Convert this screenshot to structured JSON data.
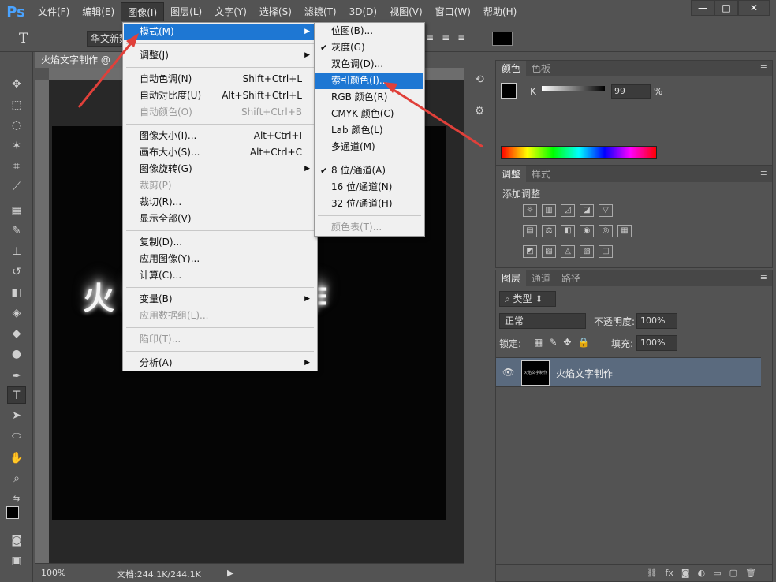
{
  "app": {
    "logo": "Ps"
  },
  "menubar": {
    "items": [
      "文件(F)",
      "编辑(E)",
      "图像(I)",
      "图层(L)",
      "文字(Y)",
      "选择(S)",
      "滤镜(T)",
      "3D(D)",
      "视图(V)",
      "窗口(W)",
      "帮助(H)"
    ],
    "active_index": 2
  },
  "window_controls": {
    "minimize": "—",
    "maximize": "□",
    "close": "✕"
  },
  "options_bar": {
    "font_family": "华文新魏"
  },
  "document": {
    "tab_title": "火焰文字制作 @",
    "canvas_text": "火焰文字制作",
    "zoom": "100%",
    "doc_info": "文档:244.1K/244.1K"
  },
  "image_menu": {
    "items": [
      {
        "label": "模式(M)",
        "shortcut": "",
        "submenu": true,
        "disabled": false,
        "highlight": true
      },
      {
        "sep": true
      },
      {
        "label": "调整(J)",
        "shortcut": "",
        "submenu": true,
        "disabled": false
      },
      {
        "sep": true
      },
      {
        "label": "自动色调(N)",
        "shortcut": "Shift+Ctrl+L",
        "disabled": false
      },
      {
        "label": "自动对比度(U)",
        "shortcut": "Alt+Shift+Ctrl+L",
        "disabled": false
      },
      {
        "label": "自动颜色(O)",
        "shortcut": "Shift+Ctrl+B",
        "disabled": true
      },
      {
        "sep": true
      },
      {
        "label": "图像大小(I)...",
        "shortcut": "Alt+Ctrl+I",
        "disabled": false
      },
      {
        "label": "画布大小(S)...",
        "shortcut": "Alt+Ctrl+C",
        "disabled": false
      },
      {
        "label": "图像旋转(G)",
        "shortcut": "",
        "submenu": true,
        "disabled": false
      },
      {
        "label": "裁剪(P)",
        "shortcut": "",
        "disabled": true
      },
      {
        "label": "裁切(R)...",
        "shortcut": "",
        "disabled": false
      },
      {
        "label": "显示全部(V)",
        "shortcut": "",
        "disabled": false
      },
      {
        "sep": true
      },
      {
        "label": "复制(D)...",
        "shortcut": "",
        "disabled": false
      },
      {
        "label": "应用图像(Y)...",
        "shortcut": "",
        "disabled": false
      },
      {
        "label": "计算(C)...",
        "shortcut": "",
        "disabled": false
      },
      {
        "sep": true
      },
      {
        "label": "变量(B)",
        "shortcut": "",
        "submenu": true,
        "disabled": false
      },
      {
        "label": "应用数据组(L)...",
        "shortcut": "",
        "disabled": true
      },
      {
        "sep": true
      },
      {
        "label": "陷印(T)...",
        "shortcut": "",
        "disabled": true
      },
      {
        "sep": true
      },
      {
        "label": "分析(A)",
        "shortcut": "",
        "submenu": true,
        "disabled": false
      }
    ]
  },
  "mode_submenu": {
    "items": [
      {
        "label": "位图(B)...",
        "checked": false
      },
      {
        "label": "灰度(G)",
        "checked": true
      },
      {
        "label": "双色调(D)...",
        "checked": false
      },
      {
        "label": "索引颜色(I)...",
        "checked": false,
        "highlight": true
      },
      {
        "label": "RGB 颜色(R)",
        "checked": false
      },
      {
        "label": "CMYK 颜色(C)",
        "checked": false
      },
      {
        "label": "Lab 颜色(L)",
        "checked": false
      },
      {
        "label": "多通道(M)",
        "checked": false
      },
      {
        "sep": true
      },
      {
        "label": "8 位/通道(A)",
        "checked": true
      },
      {
        "label": "16 位/通道(N)",
        "checked": false
      },
      {
        "label": "32 位/通道(H)",
        "checked": false
      },
      {
        "sep": true
      },
      {
        "label": "颜色表(T)...",
        "checked": false,
        "disabled": true
      }
    ]
  },
  "color_panel": {
    "tabs": [
      "颜色",
      "色板"
    ],
    "channel_label": "K",
    "k_value": "99",
    "unit": "%"
  },
  "adjustments_panel": {
    "tabs": [
      "调整",
      "样式"
    ],
    "title": "添加调整"
  },
  "layers_panel": {
    "tabs": [
      "图层",
      "通道",
      "路径"
    ],
    "filter_label": "类型",
    "blend_mode": "正常",
    "opacity_label": "不透明度:",
    "opacity_value": "100%",
    "lock_label": "锁定:",
    "fill_label": "填充:",
    "fill_value": "100%",
    "layers": [
      {
        "name": "火焰文字制作",
        "thumb_text": "火焰文字制作"
      }
    ]
  },
  "colors": {
    "accent": "#1e77d3",
    "arrow": "#e0403a"
  }
}
